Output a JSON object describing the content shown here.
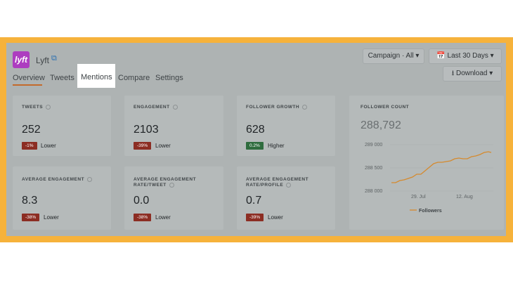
{
  "header": {
    "brand_name": "Lyft",
    "logo_text": "lyft",
    "external_link_icon": "external-link-icon",
    "campaign_label": "Campaign · All",
    "date_range_label": "Last 30 Days",
    "download_label": "Download"
  },
  "tabs": [
    {
      "label": "Overview",
      "active": true
    },
    {
      "label": "Tweets"
    },
    {
      "label": "Mentions",
      "highlighted": true
    },
    {
      "label": "Compare"
    },
    {
      "label": "Settings"
    }
  ],
  "metrics": [
    {
      "label": "TWEETS",
      "value": "252",
      "change": "-1%",
      "trend": "Lower"
    },
    {
      "label": "ENGAGEMENT",
      "value": "2103",
      "change": "-39%",
      "trend": "Lower"
    },
    {
      "label": "FOLLOWER GROWTH",
      "value": "628",
      "change": "0.2%",
      "trend": "Higher"
    },
    {
      "label": "AVERAGE ENGAGEMENT",
      "value": "8.3",
      "change": "-38%",
      "trend": "Lower"
    },
    {
      "label": "AVERAGE ENGAGEMENT RATE/TWEET",
      "value": "0.0",
      "change": "-38%",
      "trend": "Lower"
    },
    {
      "label": "AVERAGE ENGAGEMENT RATE/PROFILE",
      "value": "0.7",
      "change": "-39%",
      "trend": "Lower"
    }
  ],
  "follower_count": {
    "label": "FOLLOWER COUNT",
    "value": "288,792",
    "y_ticks": [
      "289 000",
      "288 500",
      "288 000"
    ],
    "x_ticks": [
      "29. Jul",
      "12. Aug"
    ],
    "legend": "Followers",
    "line_color": "#d58a2e"
  },
  "colors": {
    "frame": "#f6b23b",
    "logo": "#ad3dc0",
    "negative_badge": "#8c2d23",
    "positive_badge": "#2f6c3e"
  }
}
